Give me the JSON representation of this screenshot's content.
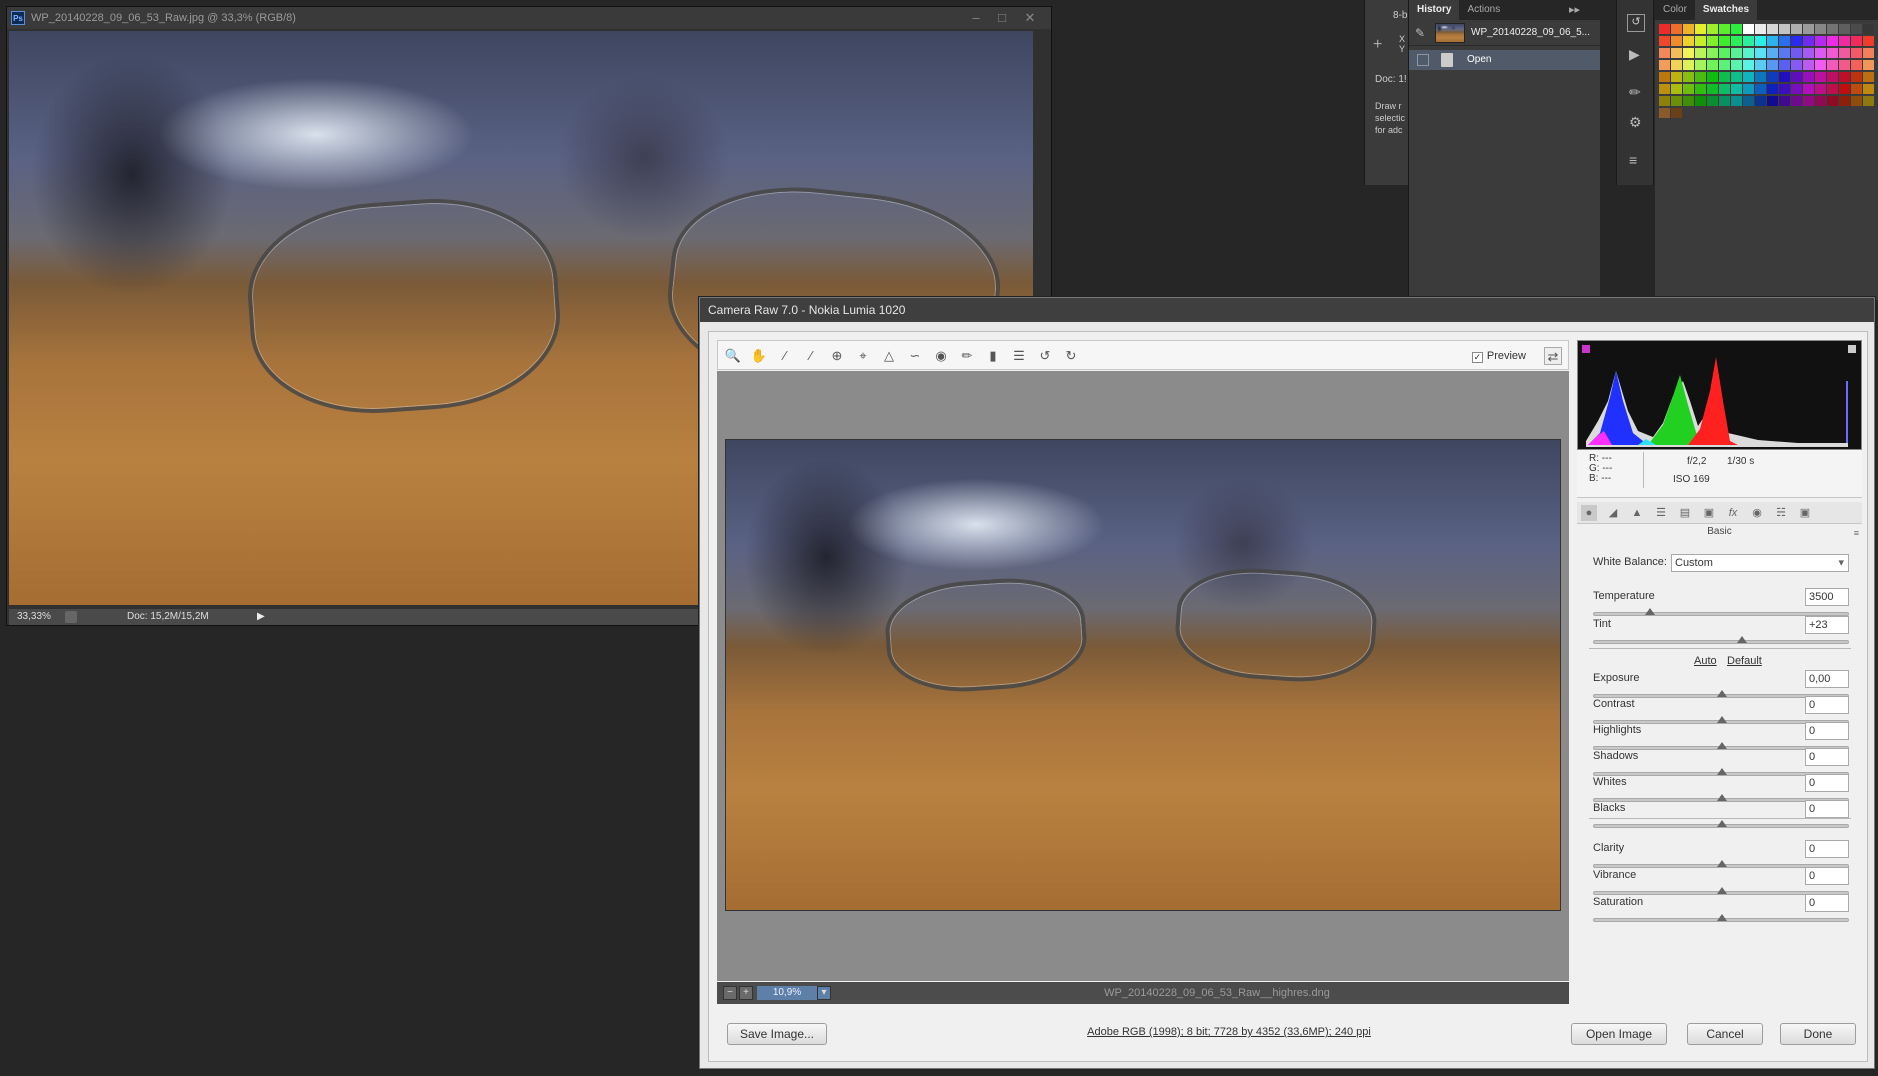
{
  "photoshop": {
    "doc_title": "WP_20140228_09_06_53_Raw.jpg @ 33,3% (RGB/8)",
    "ps_logo": "Ps",
    "zoom": "33,33%",
    "doc_size": "Doc: 15,2M/15,2M",
    "window_controls": [
      "minimize-icon",
      "restore-icon",
      "close-icon"
    ],
    "info_fragments": {
      "bit_label": "8-b",
      "xy_x": "X",
      "xy_y": "Y",
      "doc_label": "Doc: 1!",
      "hint_lines": [
        "Draw r",
        "selectic",
        "for adc"
      ]
    }
  },
  "history_panel": {
    "tabs": [
      {
        "label": "History",
        "active": true
      },
      {
        "label": "Actions",
        "active": false
      }
    ],
    "items": [
      {
        "label": "WP_20140228_09_06_5...",
        "type": "snapshot"
      },
      {
        "label": "Open",
        "type": "step",
        "selected": true
      }
    ]
  },
  "swatches_panel": {
    "tabs": [
      {
        "label": "Color",
        "active": false
      },
      {
        "label": "Swatches",
        "active": true
      }
    ]
  },
  "camera_raw": {
    "title": "Camera Raw 7.0  -  Nokia Lumia 1020",
    "preview_label": "Preview",
    "preview_checked": true,
    "tools": [
      "zoom-icon",
      "hand-icon",
      "white-balance-icon",
      "color-sampler-icon",
      "target-adjust-icon",
      "crop-icon",
      "straighten-icon",
      "spot-removal-icon",
      "red-eye-icon",
      "adjustment-brush-icon",
      "graduated-filter-icon",
      "preferences-icon",
      "rotate-left-icon",
      "rotate-right-icon"
    ],
    "zoom_value": "10,9%",
    "filename": "WP_20140228_09_06_53_Raw__highres.dng",
    "workflow_link": "Adobe RGB (1998); 8 bit; 7728 by 4352 (33,6MP); 240 ppi",
    "buttons": {
      "save": "Save Image...",
      "open": "Open Image",
      "cancel": "Cancel",
      "done": "Done"
    },
    "readout": {
      "r": "R:",
      "g": "G:",
      "b": "B:",
      "r_val": "---",
      "g_val": "---",
      "b_val": "---",
      "aperture": "f/2,2",
      "shutter": "1/30 s",
      "iso": "ISO 169"
    },
    "panel_name": "Basic",
    "white_balance_label": "White Balance:",
    "white_balance_value": "Custom",
    "auto_label": "Auto",
    "default_label": "Default",
    "sliders": [
      {
        "name": "Temperature",
        "value": "3500",
        "pos": 0.22
      },
      {
        "name": "Tint",
        "value": "+23",
        "pos": 0.58
      },
      {
        "name": "Exposure",
        "value": "0,00",
        "pos": 0.5
      },
      {
        "name": "Contrast",
        "value": "0",
        "pos": 0.5
      },
      {
        "name": "Highlights",
        "value": "0",
        "pos": 0.5
      },
      {
        "name": "Shadows",
        "value": "0",
        "pos": 0.5
      },
      {
        "name": "Whites",
        "value": "0",
        "pos": 0.5
      },
      {
        "name": "Blacks",
        "value": "0",
        "pos": 0.5
      },
      {
        "name": "Clarity",
        "value": "0",
        "pos": 0.5
      },
      {
        "name": "Vibrance",
        "value": "0",
        "pos": 0.5
      },
      {
        "name": "Saturation",
        "value": "0",
        "pos": 0.5
      }
    ]
  },
  "colors": {
    "accent": "#5e7fa8",
    "ps_dark": "#262626",
    "acr_bg": "#f0f0f0"
  }
}
